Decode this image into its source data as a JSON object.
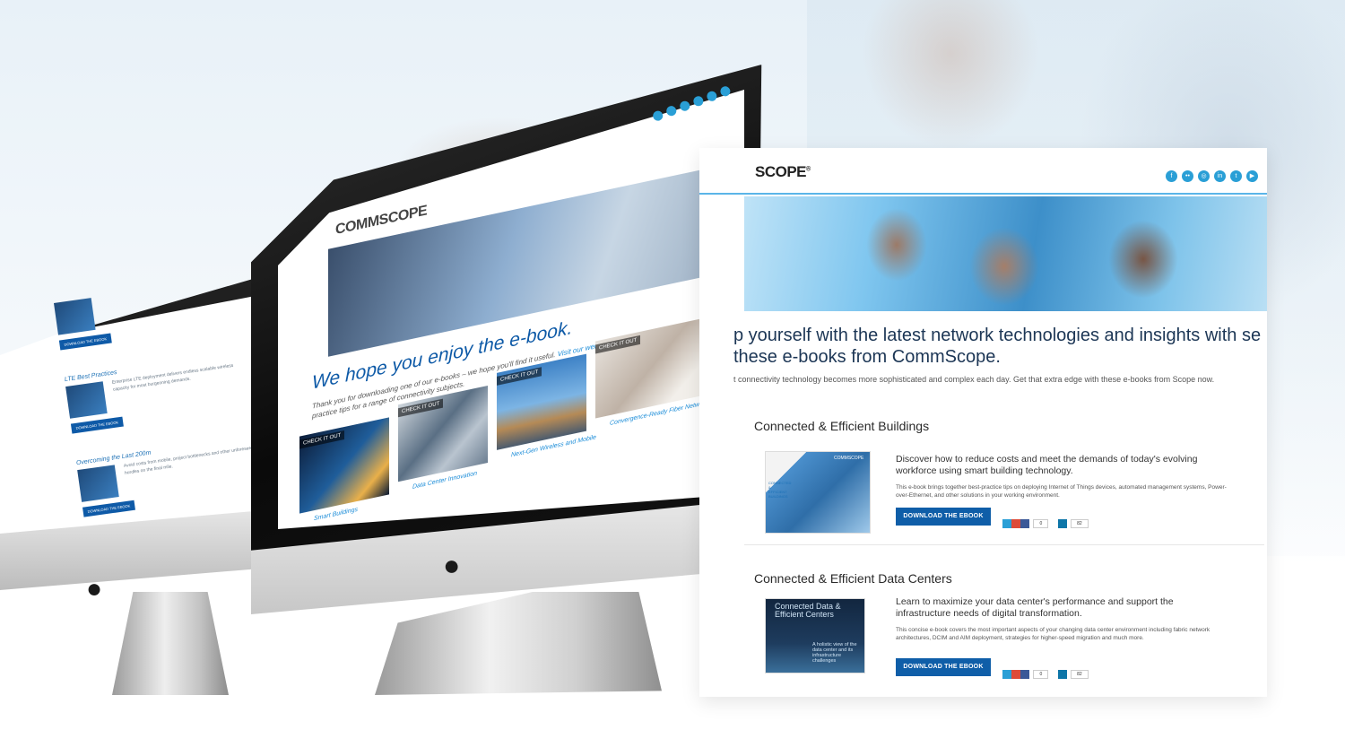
{
  "brand": {
    "logo_mid": "COMMSCOPE",
    "logo_right": "SCOPE",
    "reg": "®"
  },
  "colors": {
    "accent": "#0f5ea8",
    "social": "#2a9fd6",
    "headline": "#1c3655"
  },
  "small_screen": {
    "items": [
      {
        "title": "",
        "text": "",
        "button": "DOWNLOAD THE EBOOK"
      },
      {
        "title": "LTE Best Practices",
        "text": "Enterprise LTE deployment delivers endless scalable wireless capacity for most burgeoning demands.",
        "button": "DOWNLOAD THE EBOOK"
      },
      {
        "title": "Overcoming the Last 200m",
        "text": "Avoid costs from mobile, project bottlenecks and other unforeseen hurdles on the final mile.",
        "button": "DOWNLOAD THE EBOOK"
      }
    ]
  },
  "mid_screen": {
    "heading": "We hope you enjoy the e-book.",
    "body_before": "Thank you for downloading one of our e-books – we hope you'll find it useful. ",
    "body_link": "Visit our website",
    "body_after": " to find resources and best-practice tips for a range of connectivity subjects.",
    "tile_badge": "CHECK IT OUT",
    "tiles": [
      {
        "caption": "Smart Buildings"
      },
      {
        "caption": "Data Center Innovation"
      },
      {
        "caption": "Next-Gen Wireless and Mobile"
      },
      {
        "caption": "Convergence-Ready Fiber Networks"
      }
    ]
  },
  "right_page": {
    "social_icons": [
      "facebook-icon",
      "flickr-icon",
      "instagram-icon",
      "linkedin-icon",
      "twitter-icon",
      "youtube-icon"
    ],
    "headline": "p yourself with the latest network technologies and insights with se these e-books from CommScope.",
    "subtext": "t connectivity technology becomes more sophisticated and complex each day. Get that extra edge with these e-books from Scope now.",
    "sections": [
      {
        "title": "Connected & Efficient Buildings",
        "desc": "Discover how to reduce costs and meet the demands of today's evolving workforce using smart building technology.",
        "fine": "This e-book brings together best-practice tips on deploying Internet of Things devices, automated management systems, Power-over-Ethernet, and other solutions in your working environment.",
        "button": "DOWNLOAD THE EBOOK",
        "share_count_1": "0",
        "share_count_2": "82",
        "cover_brand": "COMMSCOPE",
        "cover_title": "CONNECTED & EFFICIENT BUILDINGS"
      },
      {
        "title": "Connected & Efficient Data Centers",
        "desc": "Learn to maximize your data center's performance and support the infrastructure needs of digital transformation.",
        "fine": "This concise e-book covers the most important aspects of your changing data center environment including fabric network architectures, DCIM and AIM deployment, strategies for higher-speed migration and much more.",
        "button": "DOWNLOAD THE EBOOK",
        "share_count_1": "0",
        "share_count_2": "82",
        "cover_title": "Connected Data & Efficient Centers",
        "cover_sub": "A holistic view of the data center and its infrastructure challenges"
      }
    ]
  }
}
